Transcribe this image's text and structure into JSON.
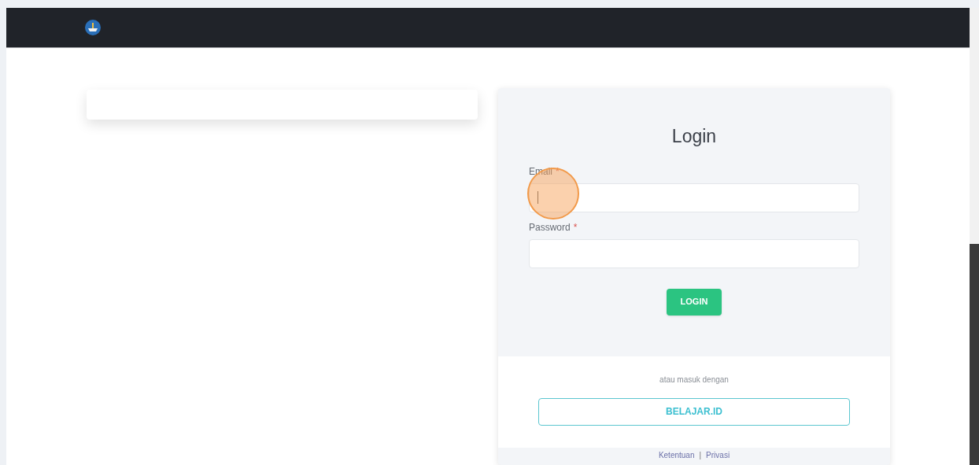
{
  "login": {
    "title": "Login",
    "fields": [
      {
        "label": "Email",
        "mark": "*",
        "focused": true
      },
      {
        "label": "Password",
        "mark": "*",
        "focused": false
      }
    ],
    "submit": "LOGIN",
    "alt_text": "atau masuk dengan",
    "alt_button": "BELAJAR.ID"
  },
  "footer_links": [
    {
      "kind": "link",
      "text": "Ketentuan"
    },
    {
      "kind": "separator",
      "text": "|"
    },
    {
      "kind": "link",
      "text": "Privasi"
    }
  ]
}
